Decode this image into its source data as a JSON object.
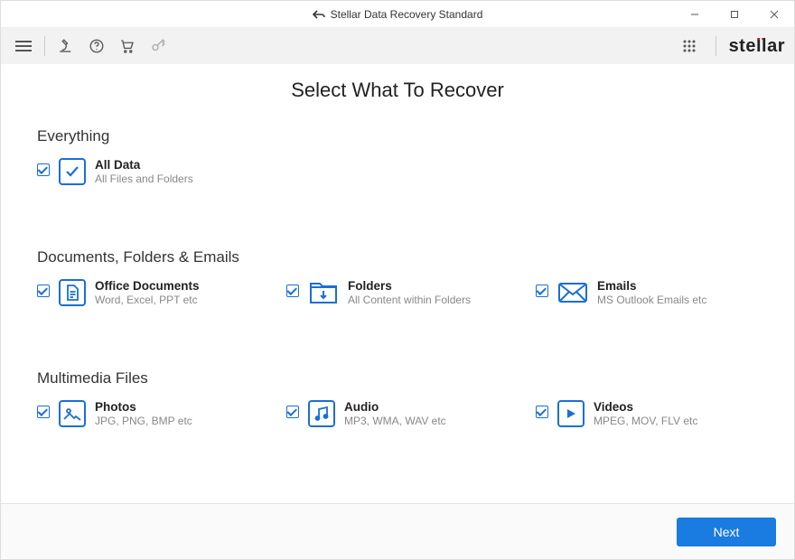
{
  "window": {
    "title": "Stellar Data Recovery Standard"
  },
  "brand": "stellar",
  "page": {
    "title": "Select What To Recover"
  },
  "sections": {
    "everything": {
      "heading": "Everything",
      "allData": {
        "title": "All Data",
        "sub": "All Files and Folders",
        "checked": true
      }
    },
    "documents": {
      "heading": "Documents, Folders & Emails",
      "items": [
        {
          "title": "Office Documents",
          "sub": "Word, Excel, PPT etc",
          "checked": true
        },
        {
          "title": "Folders",
          "sub": "All Content within Folders",
          "checked": true
        },
        {
          "title": "Emails",
          "sub": "MS Outlook Emails etc",
          "checked": true
        }
      ]
    },
    "multimedia": {
      "heading": "Multimedia Files",
      "items": [
        {
          "title": "Photos",
          "sub": "JPG, PNG, BMP etc",
          "checked": true
        },
        {
          "title": "Audio",
          "sub": "MP3, WMA, WAV etc",
          "checked": true
        },
        {
          "title": "Videos",
          "sub": "MPEG, MOV, FLV etc",
          "checked": true
        }
      ]
    }
  },
  "footer": {
    "next": "Next"
  }
}
